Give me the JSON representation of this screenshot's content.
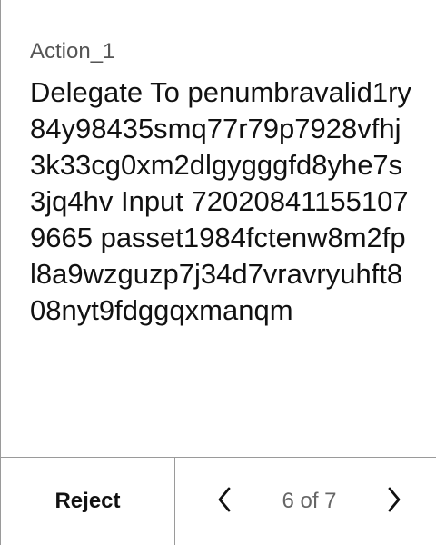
{
  "action": {
    "label": "Action_1",
    "message": "Delegate To penumbravalid1ry84y98435smq77r79p7928vfhj3k33cg0xm2dlgygggfd8yhe7s3jq4hv Input 720208411551079665 passet1984fctenw8m2fpl8a9wzguzp7j34d7vravryuhft808nyt9fdggqxmanqm"
  },
  "footer": {
    "reject_label": "Reject",
    "page_indicator": "6 of 7",
    "prev_icon": "chevron-left-icon",
    "next_icon": "chevron-right-icon"
  }
}
